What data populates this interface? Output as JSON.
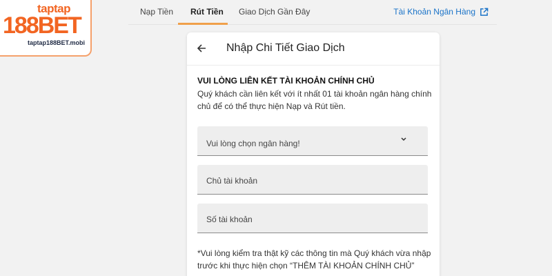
{
  "logo": {
    "top_text": "taptap",
    "main_text": "188BET",
    "url_text": "taptap188BET.mobi"
  },
  "tabs": {
    "items": [
      {
        "label": "Nạp Tiền"
      },
      {
        "label": "Rút Tiền",
        "active": true
      },
      {
        "label": "Giao Dịch Gần Đây"
      }
    ],
    "bank_account_link": "Tài Khoản Ngân Hàng"
  },
  "card": {
    "title": "Nhập Chi Tiết Giao Dịch",
    "section_title": "VUI LÒNG LIÊN KẾT TÀI KHOẢN CHÍNH CHỦ",
    "section_desc": "Quý khách cần liên kết với ít nhất 01 tài khoản ngân hàng chính chủ để có thể thực hiện Nạp và Rút tiền.",
    "bank_select_placeholder": "Vui lòng chọn ngân hàng!",
    "account_holder_placeholder": "Chủ tài khoản",
    "account_number_placeholder": "Số tài khoản",
    "note": "*Vui lòng kiểm tra thật kỹ các thông tin mà Quý khách vừa nhập trước khi thực hiện chọn “THÊM TÀI KHOẢN CHÍNH CHỦ”"
  },
  "icons": {
    "back": "arrow-left-icon",
    "chevron": "chevron-down-icon",
    "external": "external-link-icon"
  },
  "colors": {
    "brand_orange": "#f26522",
    "active_tab_underline": "#f0a04a",
    "link_blue": "#1a73c8",
    "background": "#f2f2f2"
  }
}
